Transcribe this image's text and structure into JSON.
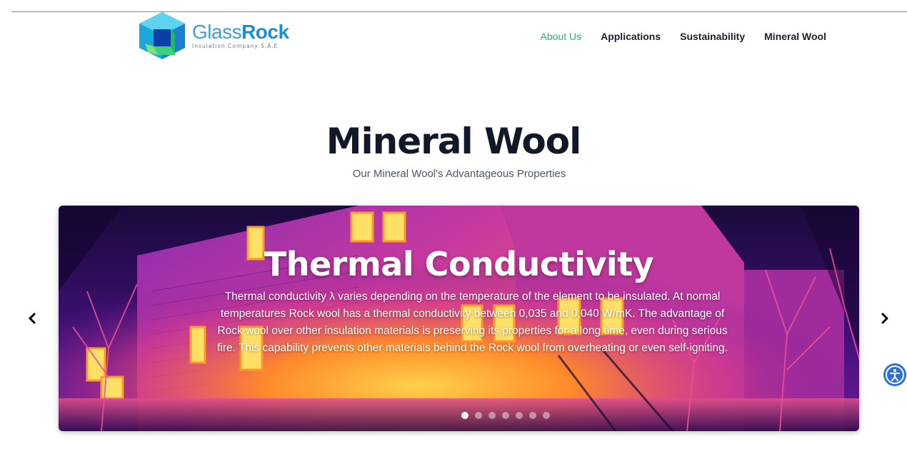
{
  "brand": {
    "name_part1": "Glass",
    "name_part2": "Rock",
    "tagline": "Insulation Company S.A.E"
  },
  "nav": {
    "items": [
      {
        "label": "About Us",
        "active": true
      },
      {
        "label": "Applications",
        "active": false
      },
      {
        "label": "Sustainability",
        "active": false
      },
      {
        "label": "Mineral Wool",
        "active": false
      }
    ]
  },
  "page": {
    "title": "Mineral Wool",
    "subtitle": "Our Mineral Wool's Advantageous Properties"
  },
  "carousel": {
    "slide_title": "Thermal Conductivity",
    "slide_text": "Thermal conductivity λ varies depending on the temperature of the element to be insulated. At normal temperatures Rock wool has a thermal conductivity between 0,035 and 0,040 W/mK. The advantage of Rock wool over other insulation materials is preserving its properties for a long time, even during serious fire. This capability prevents other materials behind the Rock wool from overheating or even self-igniting.",
    "slide_count": 7,
    "active_index": 0,
    "prev_label": "‹",
    "next_label": "›"
  },
  "colors": {
    "accent": "#2bb37a",
    "heading": "#111827",
    "brand_blue": "#1b8fd6"
  }
}
